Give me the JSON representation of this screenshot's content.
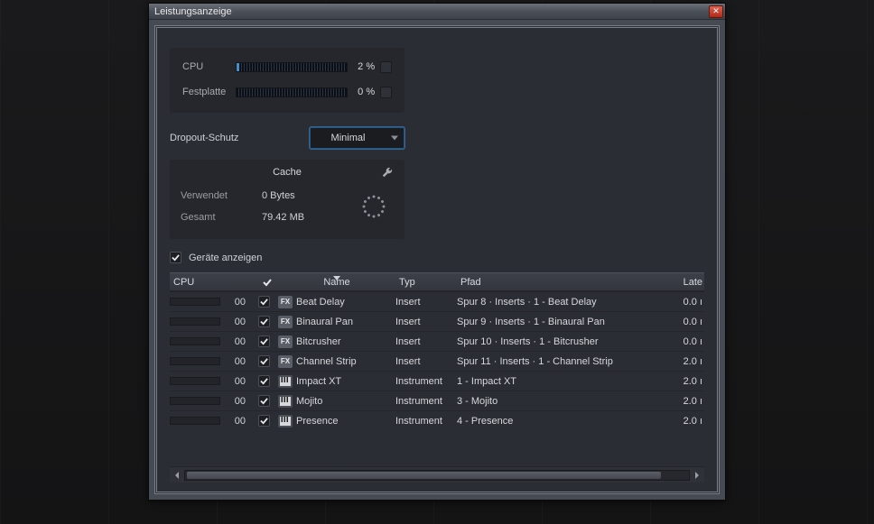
{
  "window": {
    "title": "Leistungsanzeige"
  },
  "meters": {
    "cpu_label": "CPU",
    "cpu_value": "2 %",
    "cpu_pct": 2,
    "disk_label": "Festplatte",
    "disk_value": "0 %",
    "disk_pct": 0
  },
  "dropout": {
    "label": "Dropout-Schutz",
    "selected": "Minimal"
  },
  "cache": {
    "header": "Cache",
    "used_label": "Verwendet",
    "used_value": "0 Bytes",
    "total_label": "Gesamt",
    "total_value": "79.42 MB"
  },
  "devices_checkbox": {
    "label": "Geräte anzeigen",
    "checked": true
  },
  "table": {
    "columns": {
      "cpu": "CPU",
      "name": "Name",
      "type": "Typ",
      "path": "Pfad",
      "latency": "Late"
    },
    "rows": [
      {
        "cpu": "00",
        "checked": true,
        "icon": "fx",
        "name": "Beat Delay",
        "type": "Insert",
        "path": "Spur 8 · Inserts · 1 - Beat Delay",
        "latency": "0.0 ı"
      },
      {
        "cpu": "00",
        "checked": true,
        "icon": "fx",
        "name": "Binaural Pan",
        "type": "Insert",
        "path": "Spur 9 · Inserts · 1 - Binaural Pan",
        "latency": "0.0 ı"
      },
      {
        "cpu": "00",
        "checked": true,
        "icon": "fx",
        "name": "Bitcrusher",
        "type": "Insert",
        "path": "Spur 10 · Inserts · 1 - Bitcrusher",
        "latency": "0.0 ı"
      },
      {
        "cpu": "00",
        "checked": true,
        "icon": "fx",
        "name": "Channel Strip",
        "type": "Insert",
        "path": "Spur 11 · Inserts · 1 - Channel Strip",
        "latency": "2.0 ı"
      },
      {
        "cpu": "00",
        "checked": true,
        "icon": "inst",
        "name": "Impact XT",
        "type": "Instrument",
        "path": "1 - Impact XT",
        "latency": "2.0 ı"
      },
      {
        "cpu": "00",
        "checked": true,
        "icon": "inst",
        "name": "Mojito",
        "type": "Instrument",
        "path": "3 - Mojito",
        "latency": "2.0 ı"
      },
      {
        "cpu": "00",
        "checked": true,
        "icon": "inst",
        "name": "Presence",
        "type": "Instrument",
        "path": "4 - Presence",
        "latency": "2.0 ı"
      }
    ]
  }
}
